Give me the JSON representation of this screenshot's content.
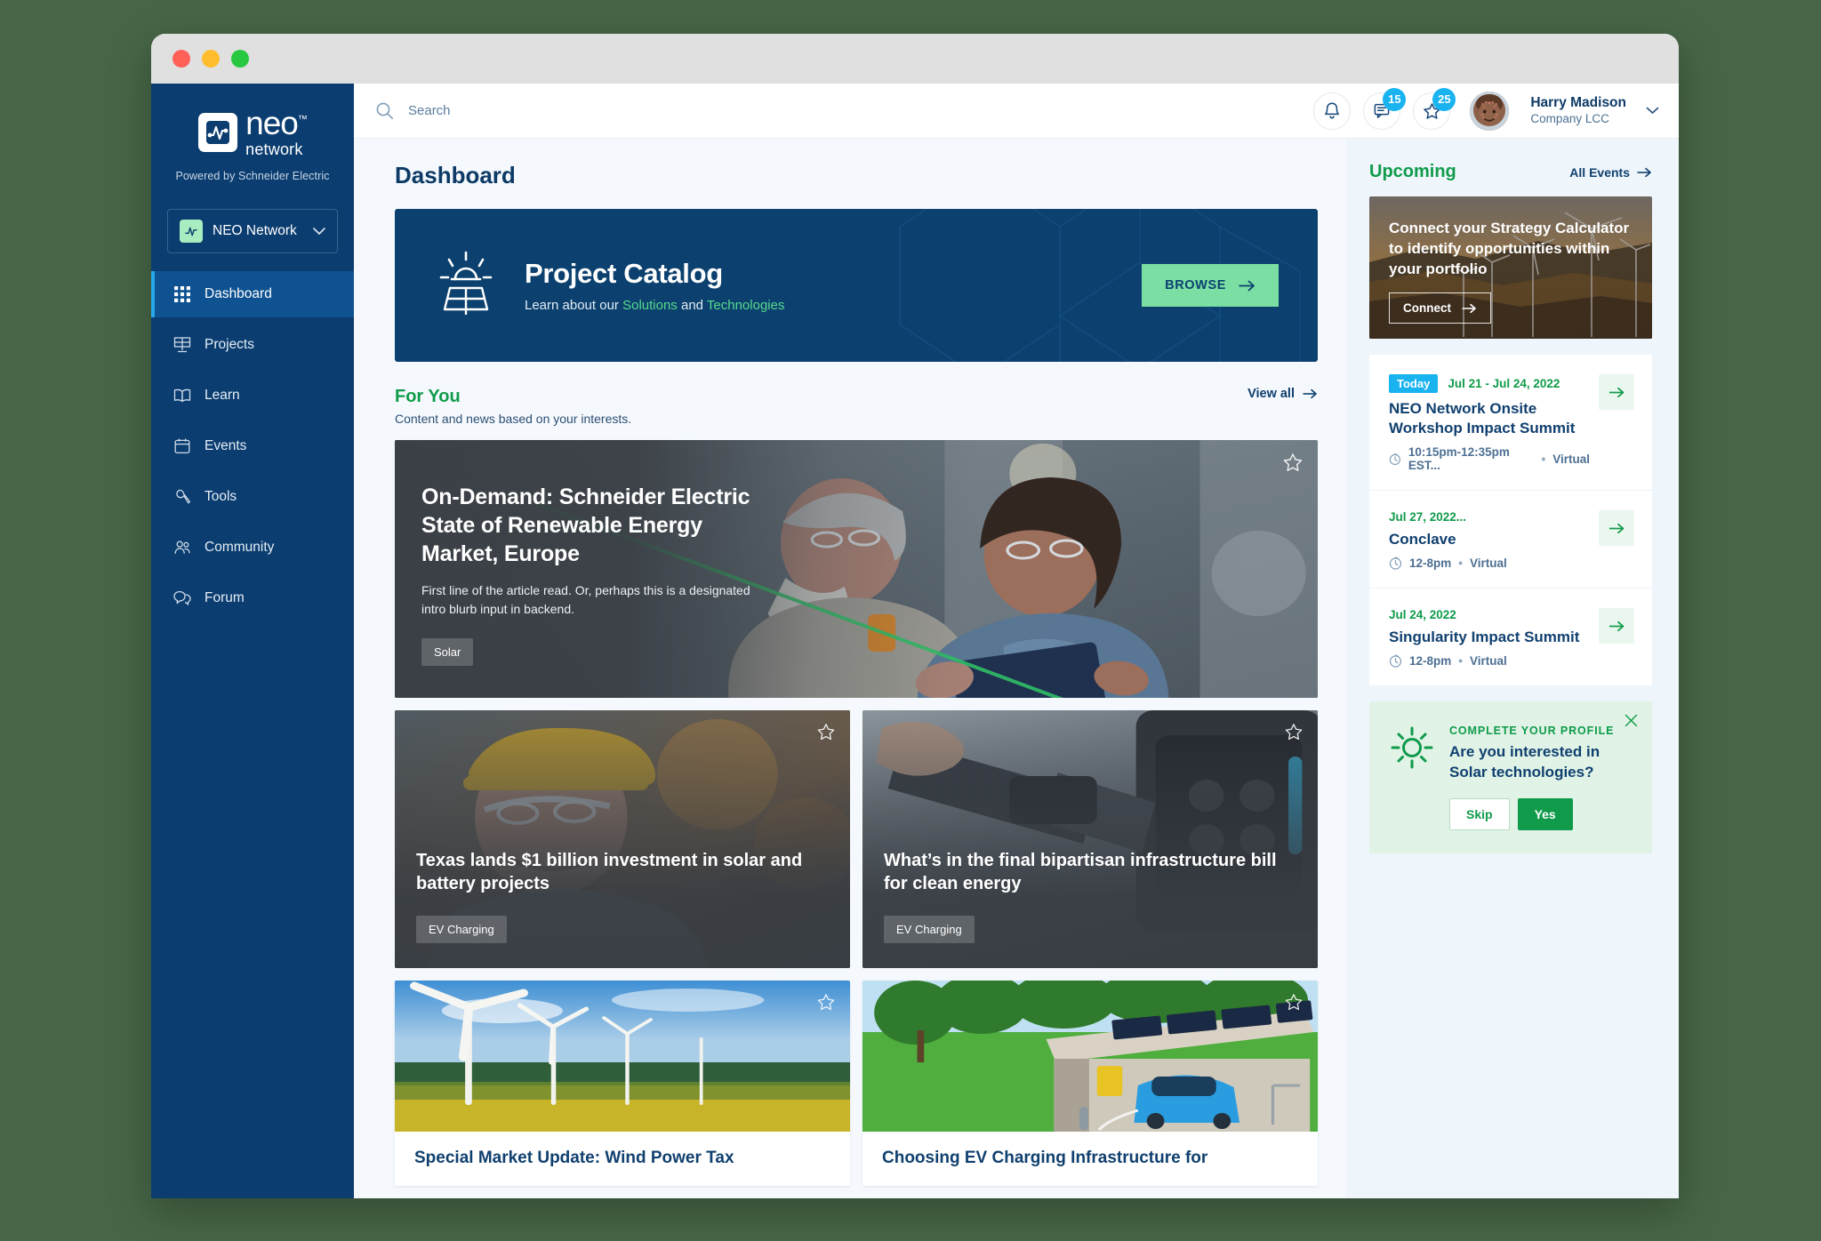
{
  "window": {
    "lights": [
      "close",
      "minimize",
      "maximize"
    ]
  },
  "sidebar": {
    "logo": {
      "neo": "neo",
      "tm": "™",
      "network": "network"
    },
    "powered_by": "Powered by Schneider Electric",
    "network_selector": {
      "label": "NEO Network",
      "chevron": "chevron-down-icon"
    },
    "items": [
      {
        "label": "Dashboard",
        "icon": "grid-icon",
        "active": true
      },
      {
        "label": "Projects",
        "icon": "solar-panel-icon",
        "active": false
      },
      {
        "label": "Learn",
        "icon": "book-icon",
        "active": false
      },
      {
        "label": "Events",
        "icon": "calendar-icon",
        "active": false
      },
      {
        "label": "Tools",
        "icon": "wrench-icon",
        "active": false
      },
      {
        "label": "Community",
        "icon": "people-icon",
        "active": false
      },
      {
        "label": "Forum",
        "icon": "chat-bubbles-icon",
        "active": false
      }
    ]
  },
  "topbar": {
    "search": {
      "placeholder": "Search",
      "value": "",
      "icon": "search-icon"
    },
    "notifications": {
      "icon": "bell-icon",
      "badge": ""
    },
    "messages": {
      "icon": "message-icon",
      "badge": "15"
    },
    "favorites": {
      "icon": "star-icon",
      "badge": "25"
    },
    "user": {
      "name": "Harry Madison",
      "org": "Company LCC",
      "chevron": "chevron-down-icon"
    }
  },
  "page": {
    "title": "Dashboard"
  },
  "banner": {
    "icon": "solar-panel-sun-icon",
    "title": "Project Catalog",
    "sub_prefix": "Learn about our ",
    "link1": "Solutions",
    "sub_mid": " and ",
    "link2": "Technologies",
    "button": "BROWSE",
    "button_arrow": "arrow-right-icon",
    "bg": "#0c416f",
    "accent": "#7bdfa3"
  },
  "for_you": {
    "title": "For You",
    "subtitle": "Content and news based on your interests.",
    "view_all": "View all",
    "view_all_arrow": "arrow-right-icon",
    "hero": {
      "title": "On-Demand: Schneider Electric State of Renewable Energy Market, Europe",
      "blurb": "First line of the article read. Or, perhaps this is a designated intro blurb input in backend.",
      "tag": "Solar",
      "bookmark": "star-outline-icon"
    },
    "cards": [
      {
        "title": "Texas lands $1 billion investment in solar and battery projects",
        "tag": "EV Charging",
        "bookmark": "star-outline-icon"
      },
      {
        "title": "What’s in the final bipartisan infrastructure bill for clean energy",
        "tag": "EV Charging",
        "bookmark": "star-outline-icon"
      }
    ],
    "bottom_cards": [
      {
        "title": "Special Market Update: Wind Power Tax",
        "bookmark": "star-outline-icon"
      },
      {
        "title": "Choosing EV Charging Infrastructure for",
        "bookmark": "star-outline-icon"
      }
    ]
  },
  "upcoming": {
    "title": "Upcoming",
    "all_events": "All Events",
    "all_events_arrow": "arrow-right-icon",
    "promo": {
      "title": "Connect your Strategy Calculator to identify opportunities within your portfolio",
      "button": "Connect",
      "button_arrow": "arrow-right-icon"
    },
    "events": [
      {
        "pill": "Today",
        "date": "Jul 21 - Jul 24, 2022",
        "name": "NEO Network Onsite Workshop Impact Summit",
        "time": "10:15pm-12:35pm EST...",
        "separator": "•",
        "location": "Virtual",
        "clock_icon": "clock-icon",
        "go_icon": "arrow-right-icon"
      },
      {
        "pill": "",
        "date": "Jul 27, 2022...",
        "name": "Conclave",
        "time": "12-8pm",
        "separator": "•",
        "location": "Virtual",
        "clock_icon": "clock-icon",
        "go_icon": "arrow-right-icon"
      },
      {
        "pill": "",
        "date": "Jul 24, 2022",
        "name": "Singularity Impact Summit",
        "time": "12-8pm",
        "separator": "•",
        "location": "Virtual",
        "clock_icon": "clock-icon",
        "go_icon": "arrow-right-icon"
      }
    ],
    "profile_prompt": {
      "icon": "sun-icon",
      "label": "COMPLETE YOUR PROFILE",
      "question": "Are you interested in Solar technologies?",
      "skip": "Skip",
      "yes": "Yes",
      "close": "close-icon"
    }
  },
  "colors": {
    "sidebar_bg": "#0b3d70",
    "accent_green": "#0f9b4a",
    "accent_blue": "#19b3f0",
    "brand_navy": "#10406f",
    "mint": "#7bdfa3"
  }
}
